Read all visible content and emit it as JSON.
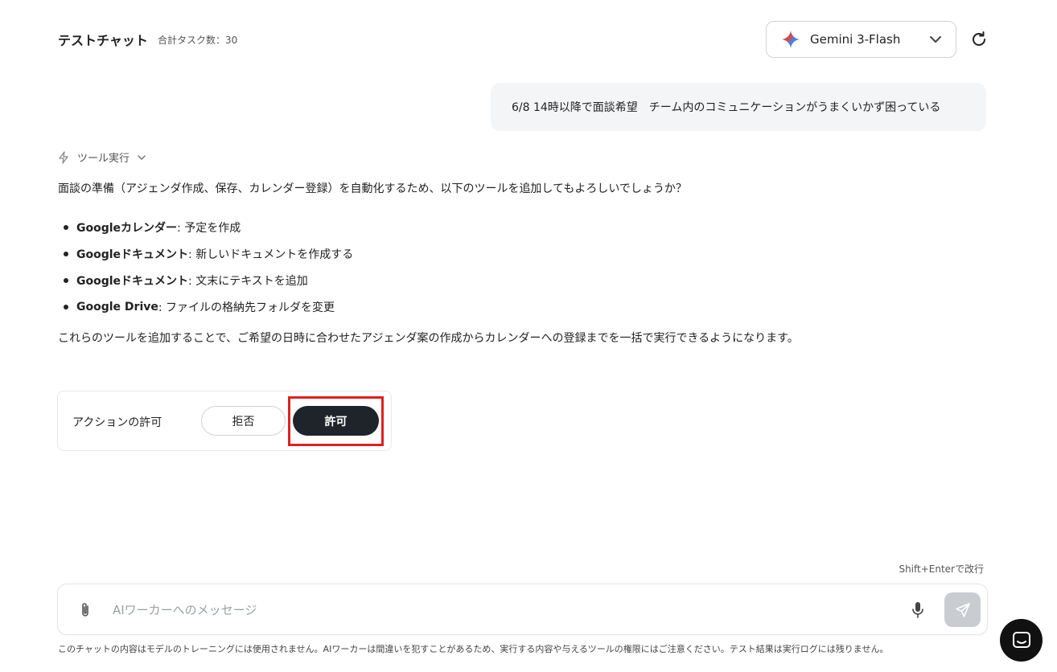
{
  "header": {
    "title": "テストチャット",
    "task_count": "合計タスク数：30"
  },
  "model_selector": {
    "label": "Gemini 3-Flash",
    "icon": "gemini-sparkle-icon"
  },
  "user_message": "6/8 14時以降で面談希望　チーム内のコミュニケーションがうまくいかず困っている",
  "assistant": {
    "tool_exec_label": "ツール実行",
    "intro": "面談の準備（アジェンダ作成、保存、カレンダー登録）を自動化するため、以下のツールを追加してもよろしいでしょうか？",
    "tools": [
      {
        "name": "Googleカレンダー",
        "desc": ": 予定を作成"
      },
      {
        "name": "Googleドキュメント",
        "desc": ": 新しいドキュメントを作成する"
      },
      {
        "name": "Googleドキュメント",
        "desc": ": 文末にテキストを追加"
      },
      {
        "name": "Google Drive",
        "desc": ": ファイルの格納先フォルダを変更"
      }
    ],
    "outro": "これらのツールを追加することで、ご希望の日時に合わせたアジェンダ案の作成からカレンダーへの登録までを一括で実行できるようになります。"
  },
  "action": {
    "label": "アクションの許可",
    "reject_label": "拒否",
    "allow_label": "許可"
  },
  "composer": {
    "hint": "Shift+Enterで改行",
    "placeholder": "AIワーカーへのメッセージ"
  },
  "disclaimer": "このチャットの内容はモデルのトレーニングには使用されません。AIワーカーは間違いを犯すことがあるため、実行する内容や与えるツールの権限にはご注意ください。テスト結果は実行ログには残りません。",
  "colors": {
    "accent_dark": "#1f242b",
    "highlight_red": "#e02020",
    "bubble_bg": "#f4f5f7"
  }
}
